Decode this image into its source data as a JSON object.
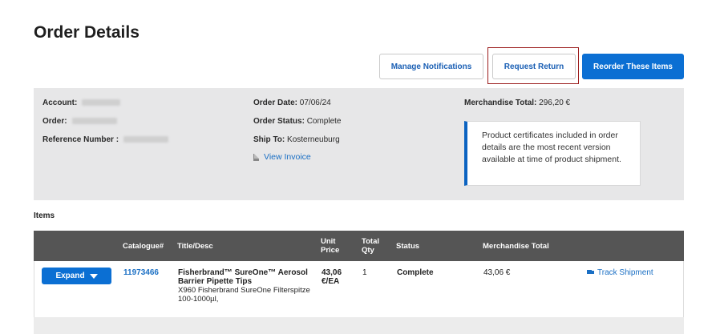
{
  "page": {
    "title": "Order Details"
  },
  "actions": {
    "manage_notifications": "Manage Notifications",
    "request_return": "Request Return",
    "reorder": "Reorder These Items"
  },
  "summary": {
    "account_label": "Account:",
    "order_label": "Order:",
    "reference_label": "Reference Number :",
    "order_date_label": "Order Date:",
    "order_date": "07/06/24",
    "order_status_label": "Order Status:",
    "order_status": "Complete",
    "ship_to_label": "Ship To:",
    "ship_to": "Kosterneuburg",
    "view_invoice": "View Invoice",
    "merch_total_label": "Merchandise Total:",
    "merch_total": "296,20 €",
    "certificate_note": "Product certificates included in order details are the most recent version available at time of product shipment."
  },
  "items": {
    "heading": "Items",
    "columns": {
      "catalogue": "Catalogue#",
      "title": "Title/Desc",
      "unit_price_1": "Unit",
      "unit_price_2": "Price",
      "total_qty_1": "Total",
      "total_qty_2": "Qty",
      "status": "Status",
      "merch_total": "Merchandise Total"
    },
    "rows": [
      {
        "expand_label": "Expand",
        "catalogue": "11973466",
        "title_1": "Fisherbrand™ SureOne™ Aerosol",
        "title_2": "Barrier Pipette Tips",
        "desc_1": "X960 Fisherbrand SureOne Filterspitze",
        "desc_2": "100-1000µl,",
        "unit_price_1": "43,06",
        "unit_price_2": "€/EA",
        "qty": "1",
        "status": "Complete",
        "merch_total": "43,06 €",
        "track_label": "Track Shipment"
      }
    ]
  },
  "icons": {
    "invoice": "document-icon",
    "track": "truck-icon",
    "expand": "caret-down-icon"
  },
  "colors": {
    "primary": "#0b6fd3",
    "link": "#1a6fc4",
    "table_header": "#555555",
    "summary_bg": "#e7e7e8",
    "highlight": "#9b1c1c"
  }
}
